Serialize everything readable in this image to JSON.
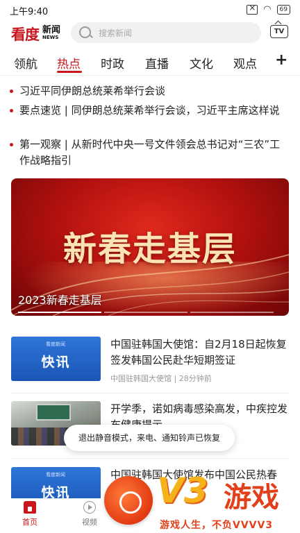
{
  "status_bar": {
    "time": "上午9:40",
    "battery": "69"
  },
  "header": {
    "logo_main": "看度",
    "logo_cn": "新闻",
    "logo_en": "NEWS",
    "search_placeholder": "搜索新闻",
    "tv_label": "TV"
  },
  "tabs": [
    {
      "label": "领航",
      "active": false
    },
    {
      "label": "热点",
      "active": true
    },
    {
      "label": "时政",
      "active": false
    },
    {
      "label": "直播",
      "active": false
    },
    {
      "label": "文化",
      "active": false
    },
    {
      "label": "观点",
      "active": false
    }
  ],
  "tab_add": "+",
  "headlines": [
    "习近平同伊朗总统莱希举行会谈",
    "要点速览 | 同伊朗总统莱希举行会谈，习近平主席这样说",
    "第一观察 | 从新时代中央一号文件领会总书记对“三农”工作战略指引"
  ],
  "banner": {
    "big_text": "新春走基层",
    "caption": "2023新春走基层"
  },
  "news": [
    {
      "thumb_type": "kuaixun",
      "thumb_brand": "看度新闻",
      "thumb_text": "快讯",
      "title": "中国驻韩国大使馆：自2月18日起恢复签发韩国公民赴华短期签证",
      "source": "中国驻韩国大使馆",
      "time": "28分钟前"
    },
    {
      "thumb_type": "class",
      "title": "开学季，诺如病毒感染高发，中疾控发布健康提示",
      "source": "",
      "time": ""
    },
    {
      "thumb_type": "kuaixun",
      "thumb_brand": "看度新闻",
      "thumb_text": "快讯",
      "title": "中国驻韩国大使馆发布中国公民热春",
      "source": "",
      "time": ""
    }
  ],
  "toast": "退出静音模式，来电、通知铃声已恢复",
  "bottom_nav": [
    {
      "label": "首页",
      "icon": "home-icon",
      "active": true
    },
    {
      "label": "视频",
      "icon": "video-icon",
      "active": false
    }
  ],
  "watermark": {
    "v3": "V3",
    "brand": "游戏",
    "slogan": "游戏人生，不负VVVV3"
  },
  "colors": {
    "accent": "#c9161c",
    "banner_red": "#b5120f",
    "kuaixun_blue": "#2e76d8"
  }
}
